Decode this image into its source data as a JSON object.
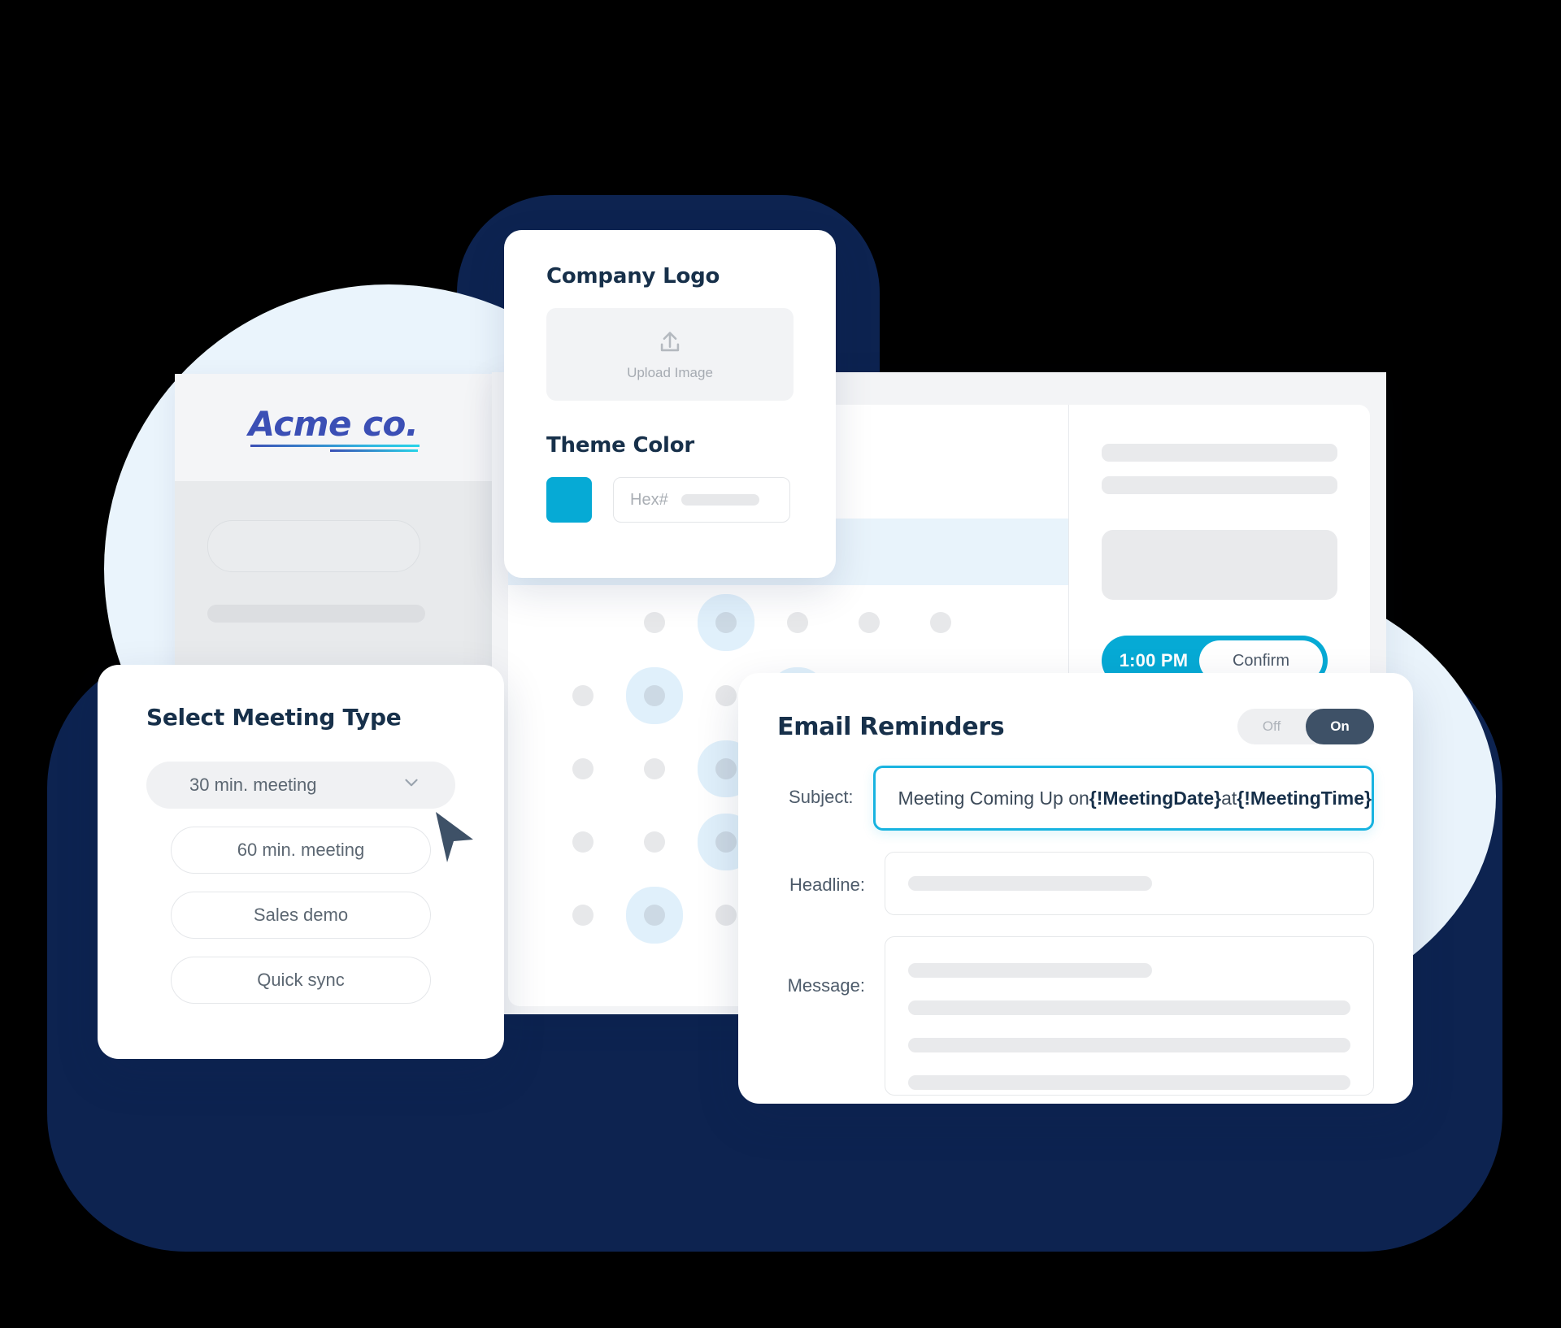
{
  "branding": {
    "logo_text": "Acme co."
  },
  "brand_card": {
    "company_logo_title": "Company Logo",
    "upload_label": "Upload Image",
    "upload_icon": "upload-icon",
    "theme_color_title": "Theme Color",
    "swatch_color": "#06aad5",
    "hex_placeholder": "Hex#"
  },
  "scheduler": {
    "confirm_time": "1:00 PM",
    "confirm_label": "Confirm"
  },
  "meeting": {
    "title": "Select Meeting Type",
    "options": [
      {
        "label": "30 min. meeting",
        "selected": true
      },
      {
        "label": "60 min. meeting",
        "selected": false
      },
      {
        "label": "Sales demo",
        "selected": false
      },
      {
        "label": "Quick sync",
        "selected": false
      }
    ],
    "chevron_icon": "chevron-down-icon",
    "cursor_icon": "cursor-arrow-icon"
  },
  "email": {
    "title": "Email Reminders",
    "toggle": {
      "off_label": "Off",
      "on_label": "On",
      "state": "On"
    },
    "subject_label": "Subject:",
    "subject_value_prefix": "Meeting Coming Up on ",
    "subject_token_date": "{!MeetingDate}",
    "subject_value_mid": " at ",
    "subject_token_time": "{!MeetingTime}",
    "headline_label": "Headline:",
    "message_label": "Message:"
  },
  "colors": {
    "navy": "#0d2350",
    "accent_cyan": "#06aad5",
    "focus_cyan": "#18b3e0",
    "toggle_on": "#3e5167",
    "logo_blue": "#3b4fb5"
  }
}
